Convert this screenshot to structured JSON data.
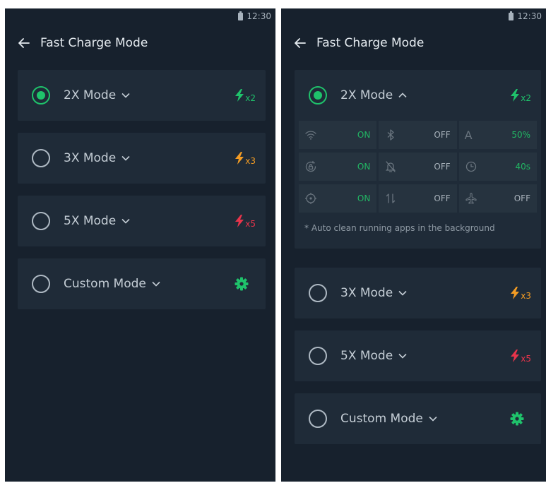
{
  "status": {
    "time": "12:30"
  },
  "header": {
    "title": "Fast Charge Mode"
  },
  "modes": [
    {
      "label": "2X Mode",
      "multiplier": "x2",
      "color": "#1fc26b",
      "selected": true
    },
    {
      "label": "3X Mode",
      "multiplier": "x3",
      "color": "#f39c24",
      "selected": false
    },
    {
      "label": "5X Mode",
      "multiplier": "x5",
      "color": "#e8344b",
      "selected": false
    },
    {
      "label": "Custom Mode",
      "icon": "gear-icon",
      "color": "#1fc26b",
      "selected": false
    }
  ],
  "settings": [
    [
      {
        "icon": "wifi-icon",
        "value": "ON"
      },
      {
        "icon": "bluetooth-icon",
        "value": "OFF"
      },
      {
        "icon": "brightness-auto-icon",
        "letter": "A",
        "value": "50%"
      }
    ],
    [
      {
        "icon": "rotation-lock-icon",
        "value": "ON"
      },
      {
        "icon": "notifications-off-icon",
        "value": "OFF"
      },
      {
        "icon": "clock-icon",
        "value": "40s"
      }
    ],
    [
      {
        "icon": "location-icon",
        "value": "ON"
      },
      {
        "icon": "mobile-data-icon",
        "value": "OFF"
      },
      {
        "icon": "airplane-icon",
        "value": "OFF"
      }
    ]
  ],
  "note": "* Auto clean running apps in the background"
}
